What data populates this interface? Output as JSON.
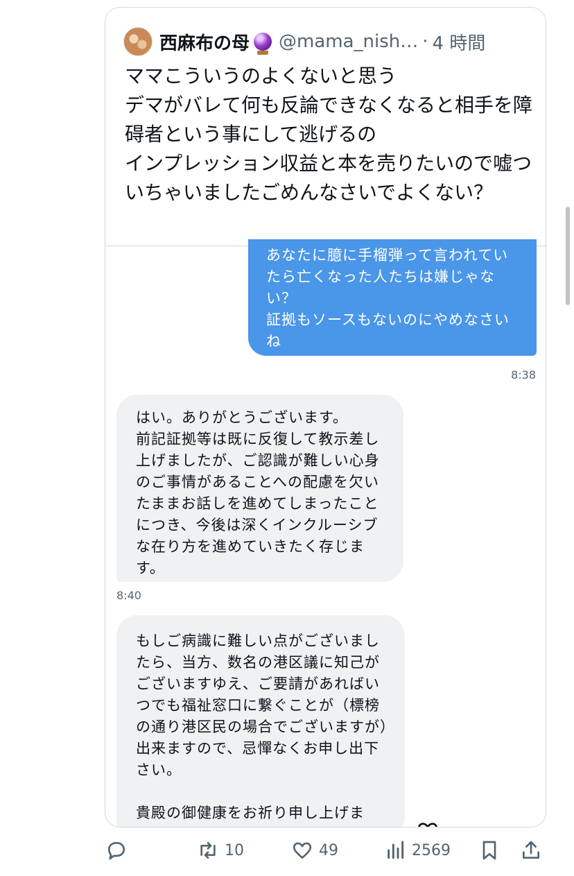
{
  "quote": {
    "display_name": "西麻布の母",
    "handle": "@mama_nish…",
    "dot": "·",
    "time": "4 時間",
    "text": "ママこういうのよくないと思う\nデマがバレて何も反論できなくなると相手を障碍者という事にして逃げるの\nインプレッション収益と本を売りたいので嘘ついちゃいましたごめんなさいでよくない？"
  },
  "messages": [
    {
      "direction": "sent",
      "text": "あなたに臆に手榴弾って言われていたら亡くなった人たちは嫌じゃない？\n証拠もソースもないのにやめなさいね",
      "time": "8:38"
    },
    {
      "direction": "received",
      "text": "はい。ありがとうございます。\n前記証拠等は既に反復して教示差し上げましたが、ご認識が難しい心身のご事情があることへの配慮を欠いたままお話しを進めてしまったことにつき、今後は深くインクルーシブな在り方を進めていきたく存じます。",
      "time": "8:40"
    },
    {
      "direction": "received",
      "text": "もしご病識に難しい点がございましたら、当方、数名の港区議に知己がございますゆえ、ご要請があればいつでも福祉窓口に繋ぐことが（標榜の通り港区民の場合でございますが）出来ますので、忌憚なくお申し出下さい。\n\n貴殿の御健康をお祈り申し上げます。"
    }
  ],
  "actions": {
    "reply_count": "",
    "retweet_count": "10",
    "like_count": "49",
    "view_count": "2569"
  },
  "colors": {
    "sent_bubble": "#4a96e8",
    "received_bubble": "#eff1f3",
    "secondary_text": "#536471"
  }
}
